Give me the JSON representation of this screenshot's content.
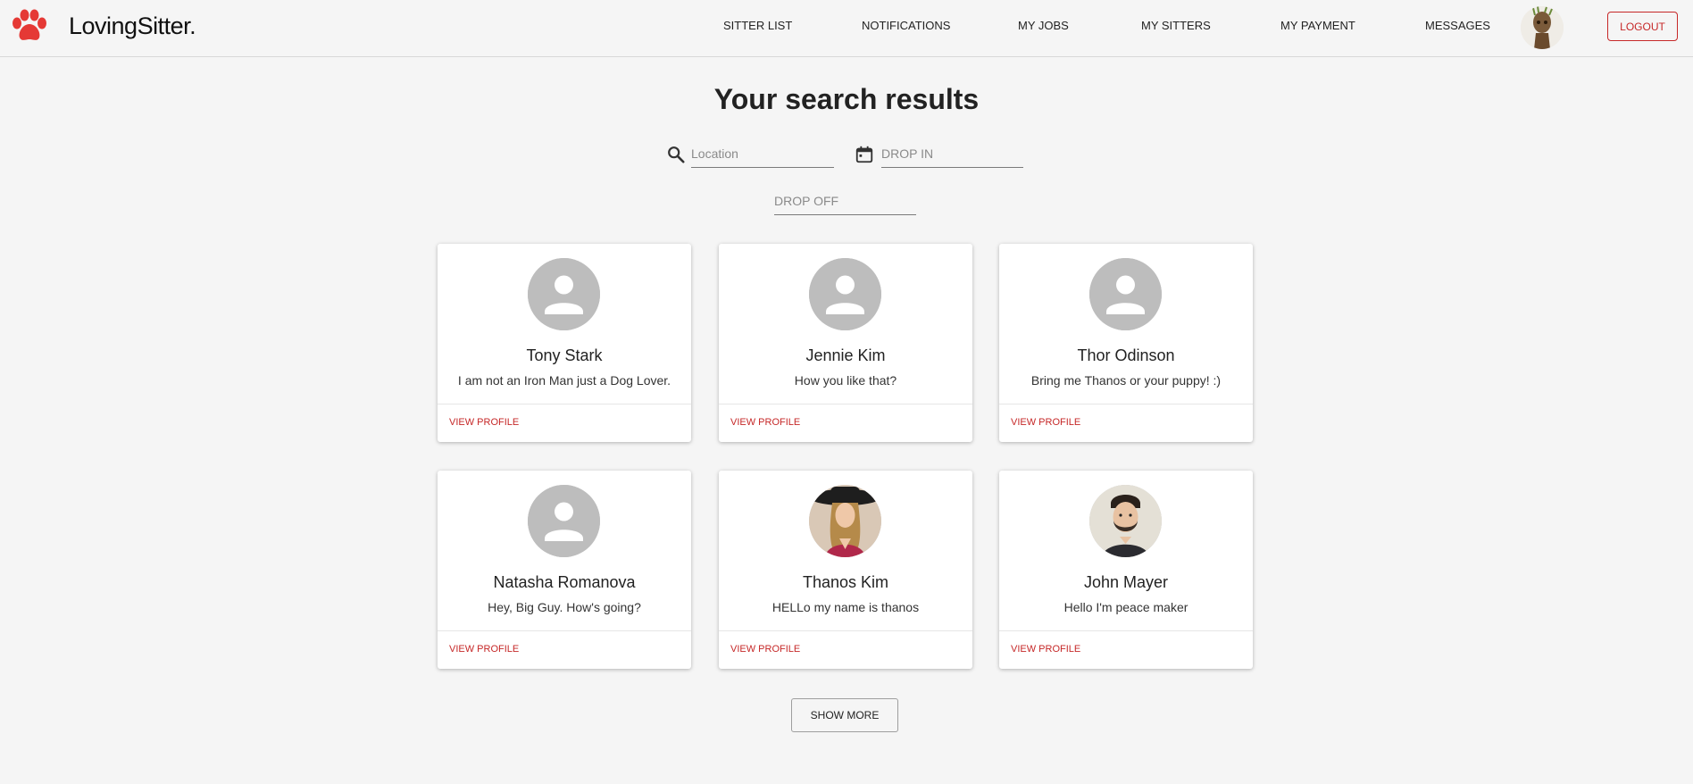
{
  "brand": {
    "name": "LovingSitter.",
    "accent": "#e53935"
  },
  "nav": {
    "items": [
      {
        "label": "SITTER LIST"
      },
      {
        "label": "NOTIFICATIONS"
      },
      {
        "label": "MY JOBS"
      },
      {
        "label": "MY SITTERS"
      },
      {
        "label": "MY PAYMENT"
      },
      {
        "label": "MESSAGES"
      }
    ],
    "logout_label": "LOGOUT"
  },
  "page": {
    "title": "Your search results"
  },
  "search": {
    "location_placeholder": "Location",
    "drop_in_placeholder": "DROP IN",
    "drop_off_placeholder": "DROP OFF"
  },
  "sitters": [
    {
      "name": "Tony Stark",
      "bio": "I am not an Iron Man just a Dog Lover.",
      "photo": "placeholder",
      "action": "VIEW PROFILE"
    },
    {
      "name": "Jennie Kim",
      "bio": "How you like that?",
      "photo": "placeholder",
      "action": "VIEW PROFILE"
    },
    {
      "name": "Thor Odinson",
      "bio": "Bring me Thanos or your puppy! :)",
      "photo": "placeholder",
      "action": "VIEW PROFILE"
    },
    {
      "name": "Natasha Romanova",
      "bio": "Hey, Big Guy. How's going?",
      "photo": "placeholder",
      "action": "VIEW PROFILE"
    },
    {
      "name": "Thanos Kim",
      "bio": "HELLo my name is thanos",
      "photo": "woman-with-hat",
      "action": "VIEW PROFILE"
    },
    {
      "name": "John Mayer",
      "bio": "Hello I'm peace maker",
      "photo": "bearded-man",
      "action": "VIEW PROFILE"
    }
  ],
  "show_more_label": "SHOW MORE",
  "colors": {
    "accent_red": "#c62828",
    "placeholder_avatar": "#bdbdbd",
    "background": "#f5f5f5"
  }
}
